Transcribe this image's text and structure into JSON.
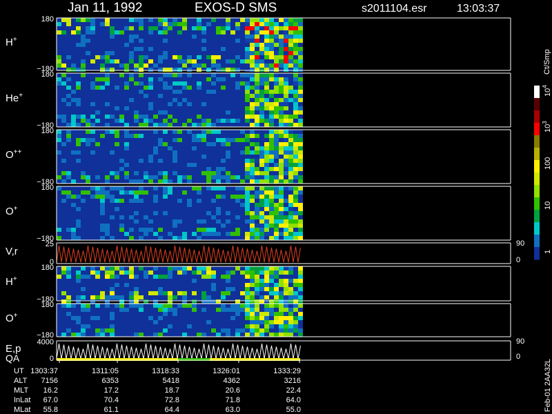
{
  "header": {
    "date": "Jan 11, 1992",
    "instrument": "EXOS-D SMS",
    "file": "s2011104.esr",
    "time": "13:03:37"
  },
  "colorbar": {
    "unit": "Ct/Smp",
    "ticks": [
      "10",
      "10",
      "100",
      "10",
      "1"
    ],
    "tick_exponents": [
      "4",
      "3",
      "",
      "",
      ""
    ],
    "tick_values": [
      10000,
      1000,
      100,
      10,
      1
    ],
    "colors": [
      "#ffffff",
      "#5a0000",
      "#a80000",
      "#ff0000",
      "#8a7a00",
      "#b8b000",
      "#fff000",
      "#d0e800",
      "#90e000",
      "#30c000",
      "#00a040",
      "#00c8c8",
      "#1070c0",
      "#10309a"
    ]
  },
  "footer": {
    "side_label": "Feb-01 2AA32L"
  },
  "chart_data": {
    "type": "heatmap",
    "x_ticks": [
      "1303:37",
      "1311:05",
      "1318:33",
      "1326:01",
      "1333:29"
    ],
    "panels": [
      {
        "species": "H",
        "charge": "+",
        "y_top": "180",
        "y_bottom": "−180"
      },
      {
        "species": "He",
        "charge": "+",
        "y_top": "180",
        "y_bottom": "−180"
      },
      {
        "species": "O",
        "charge": "++",
        "y_top": "180",
        "y_bottom": "−180"
      },
      {
        "species": "O",
        "charge": "+",
        "y_top": "180",
        "y_bottom": "−180"
      },
      {
        "species": "V,r",
        "charge": "",
        "y_top": "25",
        "y_bottom": "0",
        "right_top": "90",
        "right_bottom": "0"
      },
      {
        "species": "H",
        "charge": "+",
        "y_top": "180",
        "y_bottom": "−180"
      },
      {
        "species": "O",
        "charge": "+",
        "y_top": "180",
        "y_bottom": "−180"
      },
      {
        "species": "E,p",
        "species2": "QA",
        "charge": "",
        "y_top": "4000",
        "y_bottom": "0",
        "right_top": "90",
        "right_bottom": "0"
      }
    ],
    "ephemeris": {
      "rows": [
        {
          "name": "UT",
          "values": [
            "1303:37",
            "1311:05",
            "1318:33",
            "1326:01",
            "1333:29"
          ]
        },
        {
          "name": "ALT",
          "values": [
            "7156",
            "6353",
            "5418",
            "4362",
            "3216"
          ]
        },
        {
          "name": "MLT",
          "values": [
            "16.2",
            "17.2",
            "18.7",
            "20.6",
            "22.4"
          ]
        },
        {
          "name": "InLat",
          "values": [
            "67.0",
            "70.4",
            "72.8",
            "71.8",
            "64.0"
          ]
        },
        {
          "name": "MLat",
          "values": [
            "55.8",
            "61.1",
            "64.4",
            "63.0",
            "55.0"
          ]
        }
      ]
    }
  }
}
